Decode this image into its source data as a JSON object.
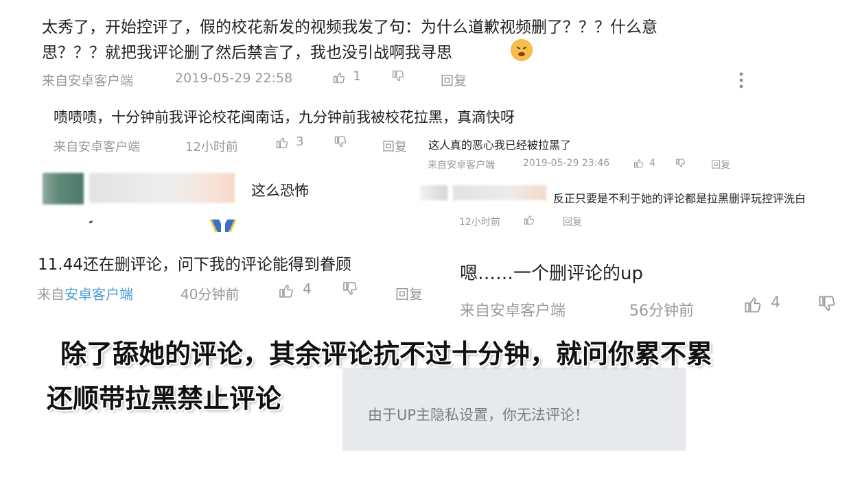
{
  "comment1": {
    "line1": "太秀了，开始控评了，假的校花新发的视频我发了句：为什么道歉视频删了？？？什么意",
    "line2": "思？？？就把我评论删了然后禁言了，我也没引战啊我寻思",
    "source": "来自安卓客户端",
    "time": "2019-05-29 22:58",
    "likes": "1",
    "reply_label": "回复"
  },
  "comment2": {
    "text": "啧啧啧，十分钟前我评论校花闽南话，九分钟前我被校花拉黑，真滴快呀",
    "source": "来自安卓客户端",
    "time": "12小时前",
    "likes": "3",
    "reply_label": "回复"
  },
  "comment3": {
    "text": "这人真的恶心我已经被拉黑了",
    "time": "2019-05-29 23:46",
    "likes": "4",
    "source": "来自安卓客户端",
    "reply_label": "回复"
  },
  "comment4": {
    "text": "这么恐怖"
  },
  "comment5": {
    "text": "反正只要是不利于她的评论都是拉黑删评玩控评洗白",
    "time": "12小时前",
    "reply_label": "回复"
  },
  "comment6": {
    "text": "11.44还在删评论，问下我的评论能得到眷顾",
    "source_prefix": "来自",
    "source_link": "安卓客户端",
    "time": "40分钟前",
    "likes": "4",
    "reply_label": "回复"
  },
  "comment7": {
    "text": "嗯……一个删评论的up",
    "source": "来自安卓客户端",
    "time": "56分钟前",
    "likes": "4"
  },
  "caption": {
    "line1": "除了舔她的评论，其余评论抗不过十分钟，就问你累不累",
    "line2": "还顺带拉黑禁止评论"
  },
  "notice": {
    "text": "由于UP主隐私设置，你无法评论！"
  },
  "colors": {
    "meta_gray": "#9a9a9a",
    "link_blue": "#4a9ad8",
    "notice_bg": "#e7e9ec"
  },
  "icons": [
    "thumb-up-icon",
    "thumb-down-icon",
    "more-icon",
    "emoji-icon"
  ]
}
